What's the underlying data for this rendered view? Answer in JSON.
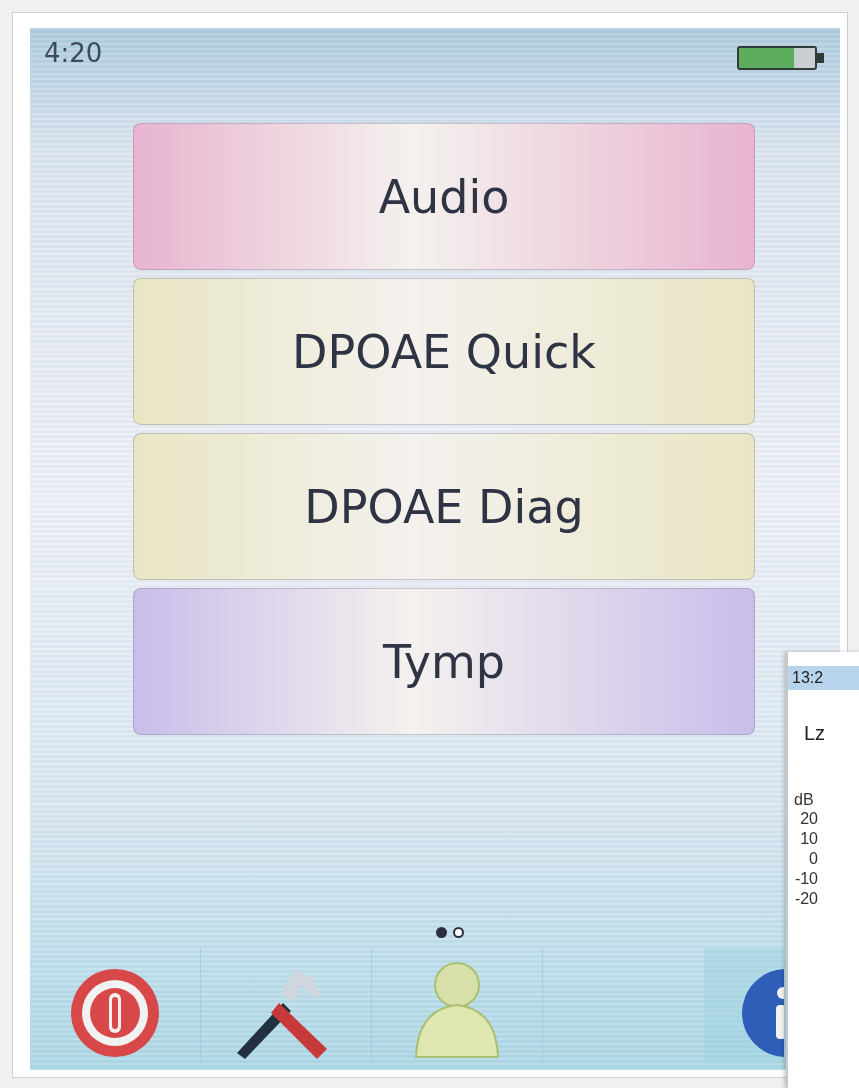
{
  "status_bar": {
    "time": "4:20",
    "battery": {
      "level": 0.72
    }
  },
  "menu": [
    {
      "label": "Audio",
      "color": "#e8b4cf"
    },
    {
      "label": "DPOAE Quick",
      "color": "#e9e6c4"
    },
    {
      "label": "DPOAE Diag",
      "color": "#e9e6c4"
    },
    {
      "label": "Tymp",
      "color": "#c9bdea"
    }
  ],
  "page_dots": [
    {
      "selected": true
    },
    {
      "selected": false
    }
  ],
  "dock": [
    {
      "kind": "power"
    },
    {
      "kind": "tools"
    },
    {
      "kind": "user"
    },
    {
      "kind": "info"
    }
  ],
  "overlay_window": {
    "time": "13:2",
    "title": "Lz",
    "unit": "dB",
    "ticks": [
      "20",
      "10",
      "0",
      "-10",
      "-20"
    ]
  }
}
